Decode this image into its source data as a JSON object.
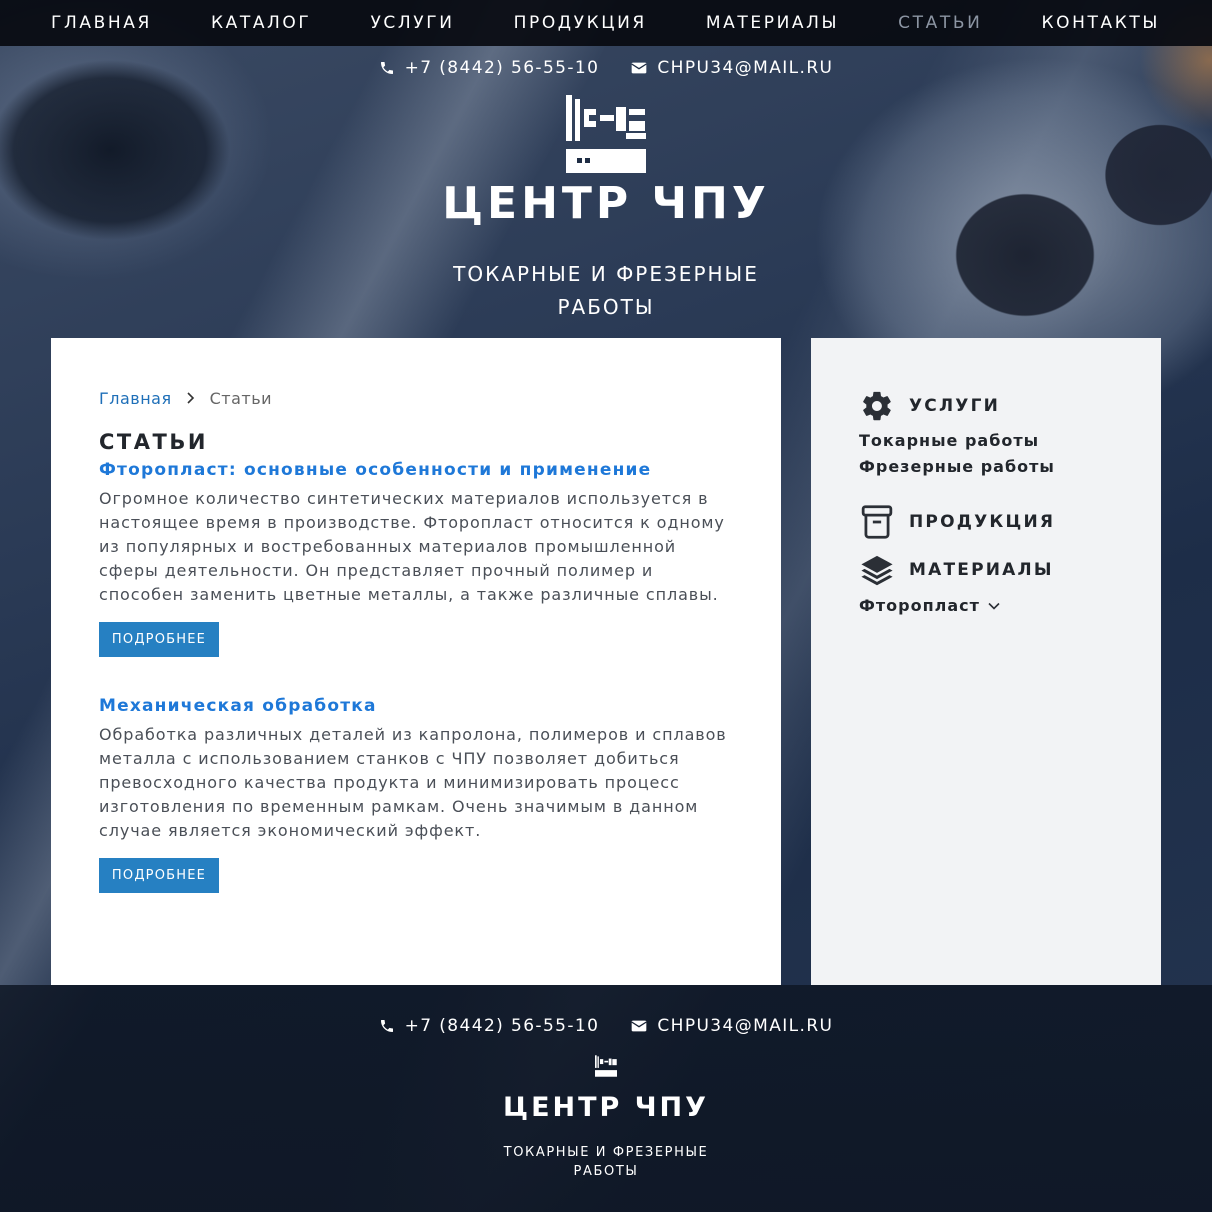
{
  "nav": {
    "items": [
      {
        "label": "Главная"
      },
      {
        "label": "Каталог"
      },
      {
        "label": "Услуги"
      },
      {
        "label": "Продукция"
      },
      {
        "label": "Материалы"
      },
      {
        "label": "Статьи"
      },
      {
        "label": "Контакты"
      }
    ],
    "active": "Статьи"
  },
  "header": {
    "phone": "+7 (8442) 56-55-10",
    "email": "CHPU34@MAIL.RU",
    "brand": "ЦЕНТР ЧПУ",
    "tagline_line1": "ТОКАРНЫЕ И ФРЕЗЕРНЫЕ",
    "tagline_line2": "РАБОТЫ"
  },
  "breadcrumb": {
    "home": "Главная",
    "current": "Статьи"
  },
  "main": {
    "title": "СТАТЬИ",
    "articles": [
      {
        "title": "Фторопласт: основные особенности и применение",
        "text": "Огромное количество синтетических материалов используется в настоящее время в производстве. Фторопласт относится к одному из популярных и востребованных материалов промышленной сферы деятельности. Он представляет прочный полимер и способен заменить цветные металлы, а также различные сплавы.",
        "button": "ПОДРОБНЕЕ"
      },
      {
        "title": "Механическая обработка",
        "text": "Обработка различных деталей из капролона, полимеров и сплавов металла с использованием станков с ЧПУ позволяет добиться превосходного качества продукта и минимизировать процесс изготовления по временным рамкам. Очень значимым в данном случае является экономический эффект.",
        "button": "ПОДРОБНЕЕ"
      }
    ]
  },
  "sidebar": {
    "services": {
      "title": "УСЛУГИ",
      "icon": "gear-icon",
      "items": [
        "Токарные работы",
        "Фрезерные работы"
      ]
    },
    "products": {
      "title": "ПРОДУКЦИЯ",
      "icon": "archive-box-icon"
    },
    "materials": {
      "title": "МАТЕРИАЛЫ",
      "icon": "layers-icon",
      "dropdown": "Фторопласт"
    }
  },
  "footer": {
    "phone": "+7 (8442) 56-55-10",
    "email": "CHPU34@MAIL.RU",
    "brand": "ЦЕНТР ЧПУ",
    "tagline_line1": "ТОКАРНЫЕ И ФРЕЗЕРНЫЕ",
    "tagline_line2": "РАБОТЫ"
  },
  "colors": {
    "nav_bg": "#0a0c12",
    "link_blue": "#1e78d8",
    "button_blue": "#2680c2",
    "sidebar_bg": "#f2f3f5",
    "nav_active": "#8c95a3"
  }
}
